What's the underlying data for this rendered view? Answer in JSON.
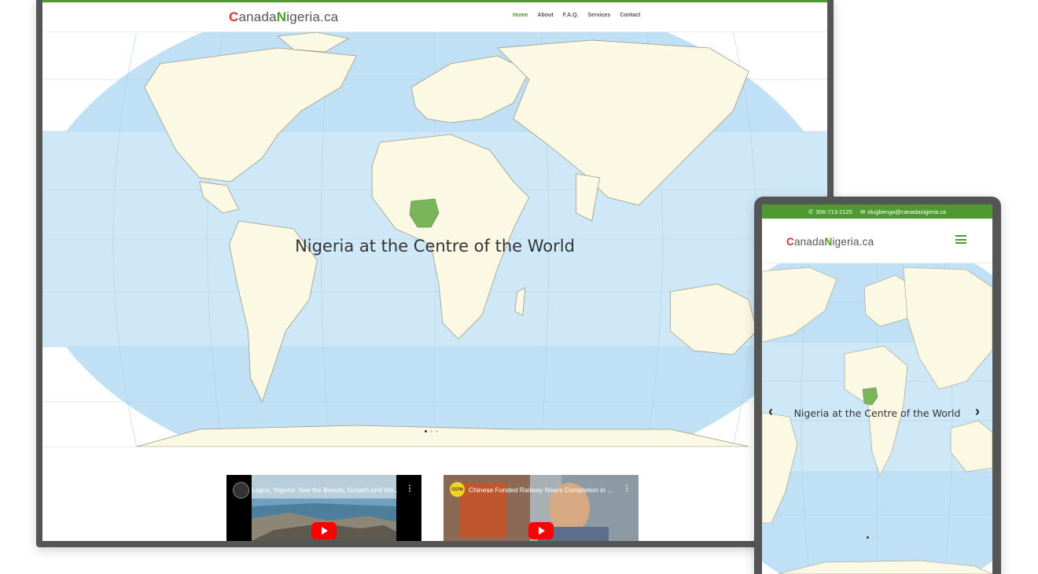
{
  "desktop": {
    "logo": {
      "c": "C",
      "anada": "anada",
      "n": "N",
      "rest": "igeria.ca"
    },
    "nav": [
      "Home",
      "About",
      "F.A.Q.",
      "Services",
      "Contact"
    ],
    "nav_active": "Home",
    "hero_title": "Nigeria at the Centre of the World",
    "slider_dots": {
      "count": 3,
      "active": 1
    },
    "videos": [
      {
        "title": "Lagos, Nigeria: See the Beauty, Growth and Wo...",
        "menu": "⋮"
      },
      {
        "title": "Chinese Funded Railway Nears Completion in ...",
        "menu": "⋮",
        "channel_badge": "CGTN"
      }
    ]
  },
  "mobile": {
    "phone": "306-713-2125",
    "email": "olugbenga@canadanigeria.ca",
    "logo": {
      "c": "C",
      "anada": "anada",
      "n": "N",
      "rest": "igeria.ca"
    },
    "hero_title": "Nigeria at the Centre of the World",
    "arrow_left": "‹",
    "arrow_right": "›",
    "slider_dots": {
      "count": 3,
      "active": 1
    }
  },
  "colors": {
    "brand_green": "#4e9a31",
    "brand_red": "#d6362b",
    "ocean": "#bfe0f5",
    "tropics": "#cfe8f8",
    "land": "#fbf8e4",
    "nigeria": "#7ab55c",
    "youtube_red": "#ff0000"
  },
  "icons": [
    "phone-icon",
    "mail-icon",
    "hamburger-menu-icon",
    "youtube-play-icon",
    "chevron-left-icon",
    "chevron-right-icon"
  ]
}
